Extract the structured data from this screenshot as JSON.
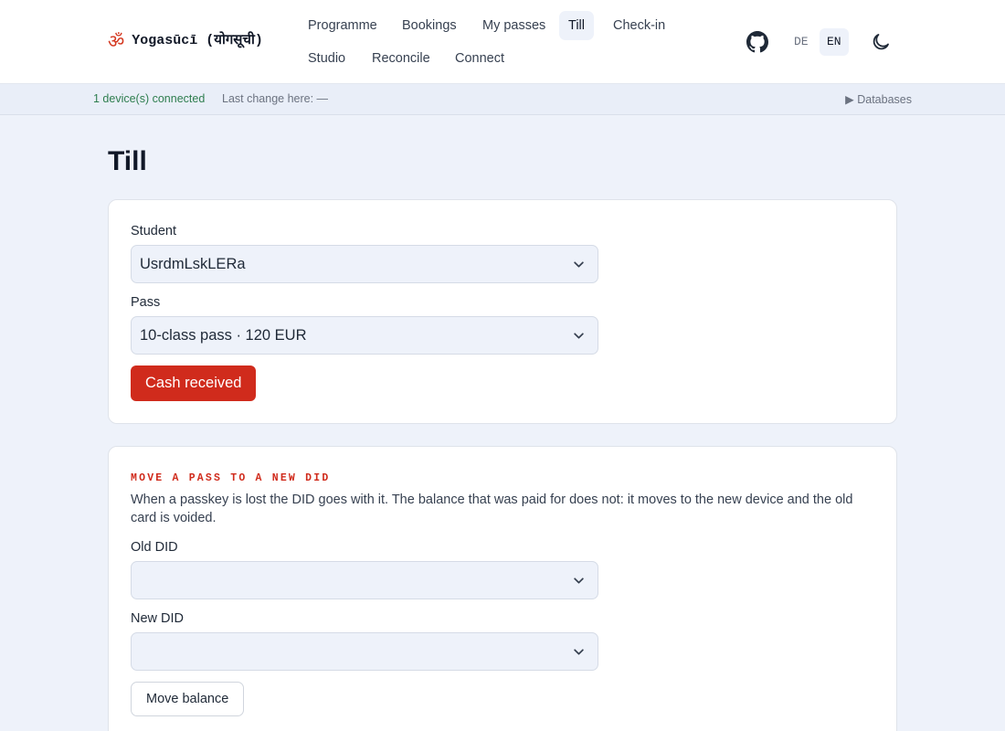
{
  "brand": {
    "symbol": "ॐ",
    "name": "Yogasūcī (योगसूची)",
    "accent": "#d4371f"
  },
  "nav": [
    {
      "label": "Programme",
      "active": false
    },
    {
      "label": "Bookings",
      "active": false
    },
    {
      "label": "My passes",
      "active": false
    },
    {
      "label": "Till",
      "active": true
    },
    {
      "label": "Check-in",
      "active": false
    },
    {
      "label": "Studio",
      "active": false
    },
    {
      "label": "Reconcile",
      "active": false
    },
    {
      "label": "Connect",
      "active": false
    }
  ],
  "header_icons": {
    "github": "github-icon",
    "theme": "moon-icon"
  },
  "lang": {
    "options": [
      "DE",
      "EN"
    ],
    "selected": "EN"
  },
  "status": {
    "connected": "1 device(s) connected",
    "last_change": "Last change here: —",
    "databases": "▶ Databases",
    "connected_color": "#2e7d4f"
  },
  "page": {
    "title": "Till"
  },
  "sale": {
    "student_label": "Student",
    "student_value": "UsrdmLskLERa",
    "pass_label": "Pass",
    "pass_value": "10-class pass · 120 EUR",
    "submit_label": "Cash received",
    "submit_color": "#d02b1c"
  },
  "move": {
    "title": "Move a pass to a new DID",
    "description": "When a passkey is lost the DID goes with it. The balance that was paid for does not: it moves to the new device and the old card is voided.",
    "old_label": "Old DID",
    "old_value": "",
    "new_label": "New DID",
    "new_value": "",
    "submit_label": "Move balance"
  }
}
